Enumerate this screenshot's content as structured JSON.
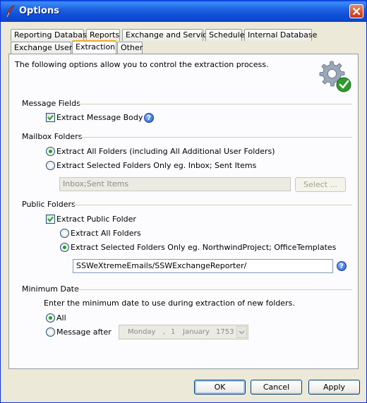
{
  "window": {
    "title": "Options"
  },
  "tabs": {
    "row1": [
      "Reporting Database",
      "Reports",
      "Exchange and Service",
      "Schedule",
      "Internal Database"
    ],
    "row2": [
      "Exchange Users",
      "Extraction",
      "Other"
    ],
    "active": "Extraction"
  },
  "intro": "The following options allow you to control the extraction process.",
  "message_fields": {
    "heading": "Message Fields",
    "extract_body_label": "Extract Message Body",
    "extract_body_checked": true
  },
  "mailbox_folders": {
    "heading": "Mailbox Folders",
    "all_label": "Extract All Folders (including All Additional User Folders)",
    "selected_label": "Extract Selected Folders Only  eg. Inbox; Sent Items",
    "selected_option": "all",
    "folders_value": "Inbox;Sent Items",
    "select_button": "Select ..."
  },
  "public_folders": {
    "heading": "Public Folders",
    "extract_label": "Extract Public Folder",
    "extract_checked": true,
    "all_label": "Extract All Folders",
    "selected_label": "Extract Selected Folders Only eg. NorthwindProject; OfficeTemplates",
    "selected_option": "selected",
    "folders_value": "SSWeXtremeEmails/SSWExchangeReporter/"
  },
  "minimum_date": {
    "heading": "Minimum Date",
    "description": "Enter the minimum date to use during extraction of new folders.",
    "all_label": "All",
    "after_label": "Message after",
    "selected_option": "all",
    "date_day": "Monday",
    "date_sep1": ",",
    "date_num": "1",
    "date_month": "January",
    "date_year": "1753"
  },
  "buttons": {
    "ok": "OK",
    "cancel": "Cancel",
    "apply": "Apply"
  },
  "icons": {
    "title": "feather-icon",
    "settings": "gear-check-icon",
    "help": "help-icon"
  },
  "colors": {
    "titlebar": "#0a44c7",
    "accent_tab": "#f5a623",
    "radio_dot": "#21a121",
    "check_badge": "#2d9b2d"
  }
}
